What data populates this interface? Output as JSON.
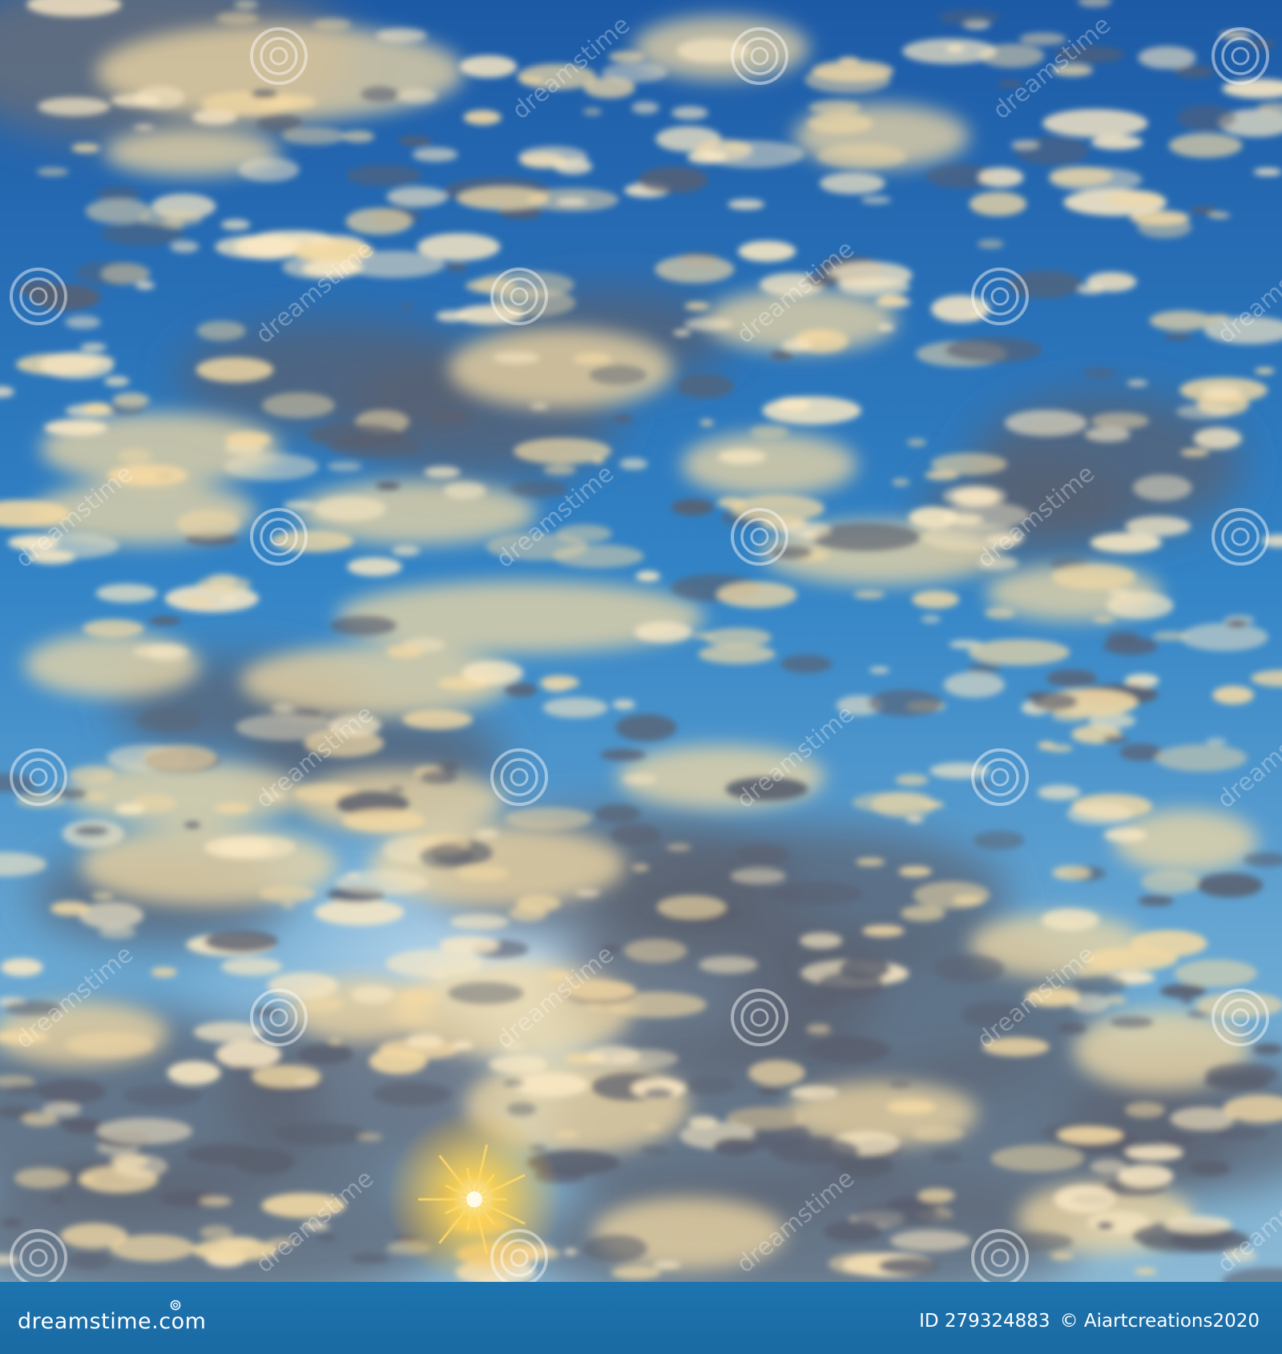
{
  "photo": {
    "subject": "sunset sky with golden lit clouds",
    "colors": {
      "sky_top": "#1f5fa8",
      "sky_mid": "#3a86c4",
      "sky_low": "#7fb4d6",
      "cloud_light": "#f3d9a4",
      "cloud_dark": "#5a5f6e",
      "sun": "#ffcc33"
    },
    "watermark_text": "dreamstime"
  },
  "footer": {
    "brand": "dreamstime.com",
    "id_label": "ID 279324883",
    "credit": "© Aiartcreations2020",
    "bar_color": "#1b6fa8"
  }
}
